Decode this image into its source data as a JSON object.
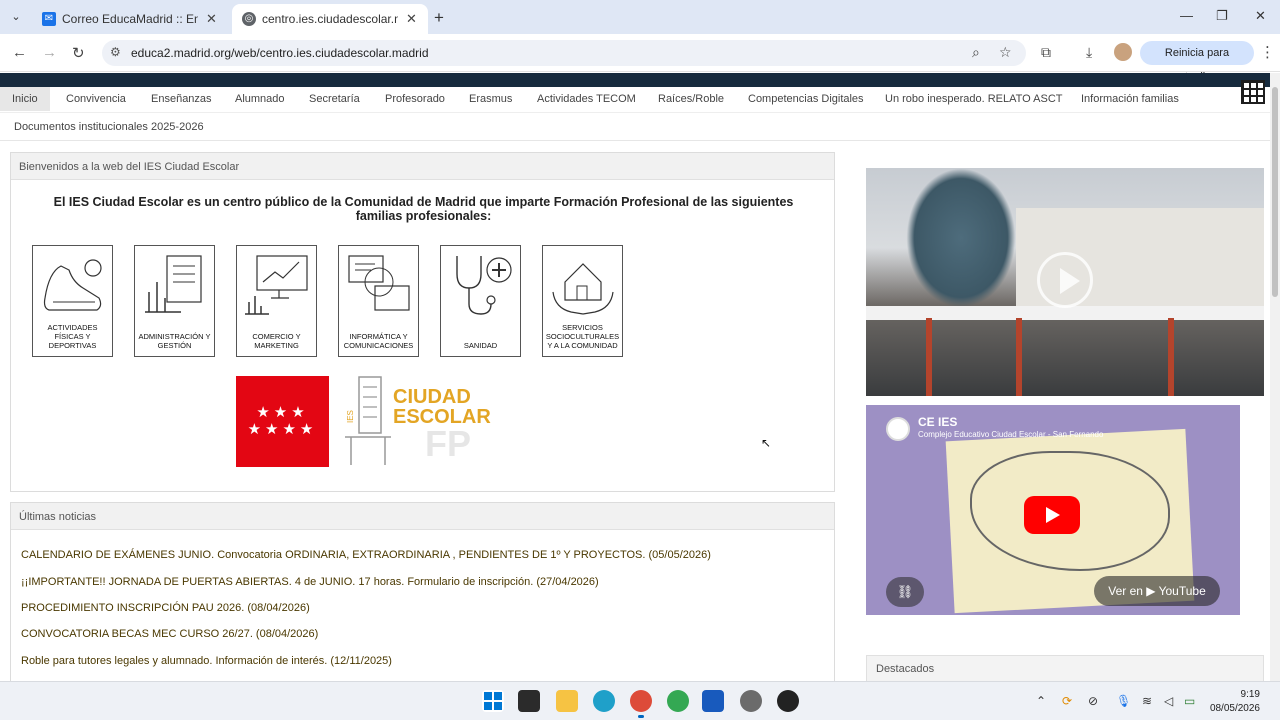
{
  "browser": {
    "tabs": [
      {
        "title": "Correo EducaMadrid :: Entrada",
        "active": false
      },
      {
        "title": "centro.ies.ciudadescolar.madrid",
        "active": true
      }
    ],
    "url": "educa2.madrid.org/web/centro.ies.ciudadescolar.madrid",
    "update_label": "Reinicia para actualizar",
    "icons": {
      "back": "arrow-left-icon",
      "forward": "arrow-right-icon",
      "reload": "reload-icon",
      "zoom": "zoom-icon",
      "star": "star-icon",
      "extensions": "extensions-icon",
      "download": "download-icon",
      "menu": "kebab-icon"
    }
  },
  "site": {
    "nav": [
      "Inicio",
      "Convivencia",
      "Enseñanzas",
      "Alumnado",
      "Secretaría",
      "Profesorado",
      "Erasmus",
      "Actividades TECOM",
      "Raíces/Roble",
      "Competencias Digitales",
      "Un robo inesperado. RELATO ASCT",
      "Información familias"
    ],
    "subnav": "Documentos institucionales 2025-2026",
    "welcome": {
      "heading": "Bienvenidos a la web del IES Ciudad Escolar",
      "intro": "El IES Ciudad Escolar es un centro público de la Comunidad de Madrid que imparte Formación Profesional de las siguientes familias profesionales:",
      "families": [
        "ACTIVIDADES FÍSICAS Y DEPORTIVAS",
        "ADMINISTRACIÓN Y GESTIÓN",
        "COMERCIO Y MARKETING",
        "INFORMÁTICA Y COMUNICACIONES",
        "SANIDAD",
        "SERVICIOS SOCIOCULTURALES Y A LA COMUNIDAD"
      ],
      "logo_text": {
        "ies": "IES",
        "name_line1": "CIUDAD",
        "name_line2": "ESCOLAR",
        "fp": "FP"
      }
    },
    "news": {
      "heading": "Últimas noticias",
      "items": [
        "CALENDARIO DE EXÁMENES JUNIO. Convocatoria ORDINARIA, EXTRAORDINARIA , PENDIENTES DE 1º Y PROYECTOS. (05/05/2026)",
        "¡¡IMPORTANTE!! JORNADA DE PUERTAS ABIERTAS. 4 de JUNIO. 17 horas. Formulario de inscripción. (27/04/2026)",
        "PROCEDIMIENTO INSCRIPCIÓN PAU 2026. (08/04/2026)",
        "CONVOCATORIA BECAS MEC CURSO 26/27. (08/04/2026)",
        "Roble para tutores legales y alumnado. Información de interés. (12/11/2025)"
      ]
    },
    "video2": {
      "channel": "CE IES",
      "subtitle": "Complejo Educativo Ciudad Escolar - San Fernando",
      "watch_on": "Ver en ▶ YouTube"
    },
    "destacados": "Destacados"
  },
  "taskbar": {
    "time": "9:19",
    "date": "08/05/2026"
  },
  "colors": {
    "accent": "#172b3e",
    "news_text": "#4a3800",
    "logo_gold": "#e3a524",
    "cam_red": "#e30613"
  }
}
